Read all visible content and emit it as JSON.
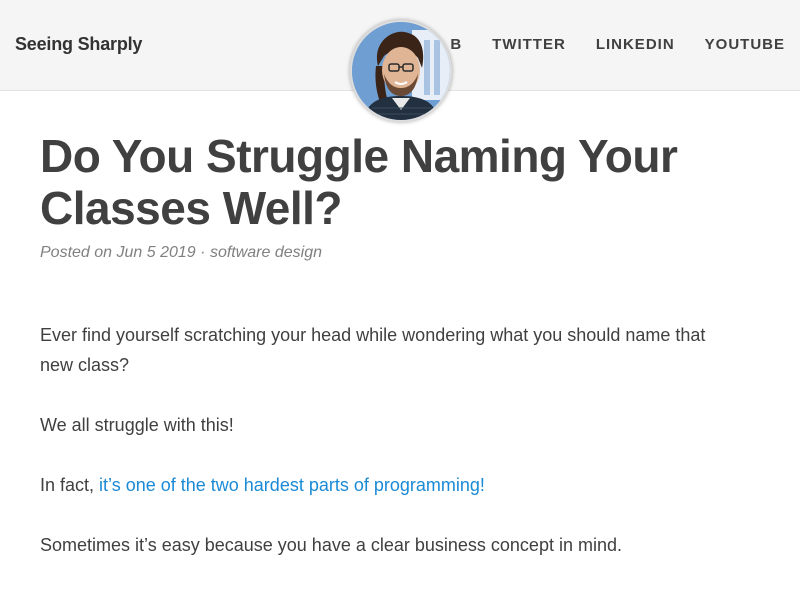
{
  "navbar": {
    "brand": "Seeing Sharply",
    "links": [
      "B",
      "TWITTER",
      "LINKEDIN",
      "YOUTUBE"
    ]
  },
  "post": {
    "title": "Do You Struggle Naming Your Classes Well?",
    "meta": {
      "prefix": "Posted on",
      "date": "Jun 5 2019",
      "separator": "·",
      "tag": "software design"
    },
    "paragraphs": {
      "p1": "Ever find yourself scratching your head while wondering what you should name that new class?",
      "p2": "We all struggle with this!",
      "p3_prefix": "In fact, ",
      "p3_link": "it’s one of the two hardest parts of programming!",
      "p4": "Sometimes it’s easy because you have a clear business concept in mind."
    }
  },
  "colors": {
    "link": "#1a8ad6",
    "navbar_bg": "#f5f5f5",
    "text": "#404040",
    "meta": "#808080"
  },
  "icons": {
    "avatar": "author-avatar"
  }
}
